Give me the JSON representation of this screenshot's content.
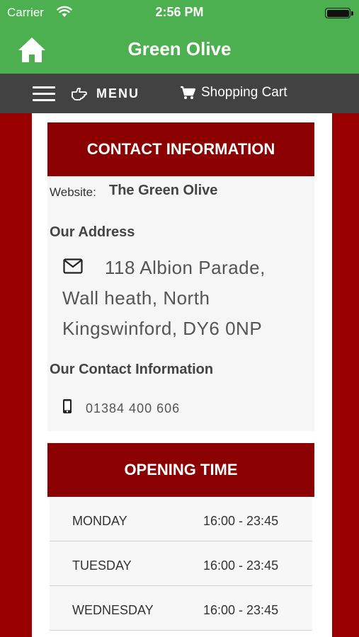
{
  "status_bar": {
    "carrier": "Carrier",
    "time": "2:56 PM"
  },
  "header": {
    "title": "Green Olive",
    "home_icon": "home-icon",
    "color": "#4caf50"
  },
  "nav": {
    "menu_label": "MENU",
    "cart_label": "Shopping Cart",
    "background": "#424242"
  },
  "contact": {
    "heading": "CONTACT INFORMATION",
    "website_label": "Website:",
    "website_value": "The Green Olive",
    "address_title": "Our Address",
    "address": "118 Albion Parade, Wall heath, North Kingswinford, DY6 0NP",
    "contact_title": "Our Contact Information",
    "phone": "01384 400 606"
  },
  "opening": {
    "heading": "OPENING TIME",
    "rows": [
      {
        "day": "MONDAY",
        "time": "16:00 - 23:45"
      },
      {
        "day": "TUESDAY",
        "time": "16:00 - 23:45"
      },
      {
        "day": "WEDNESDAY",
        "time": "16:00 - 23:45"
      }
    ]
  },
  "colors": {
    "page_background": "#9b0000",
    "section_header": "#8b0000"
  }
}
